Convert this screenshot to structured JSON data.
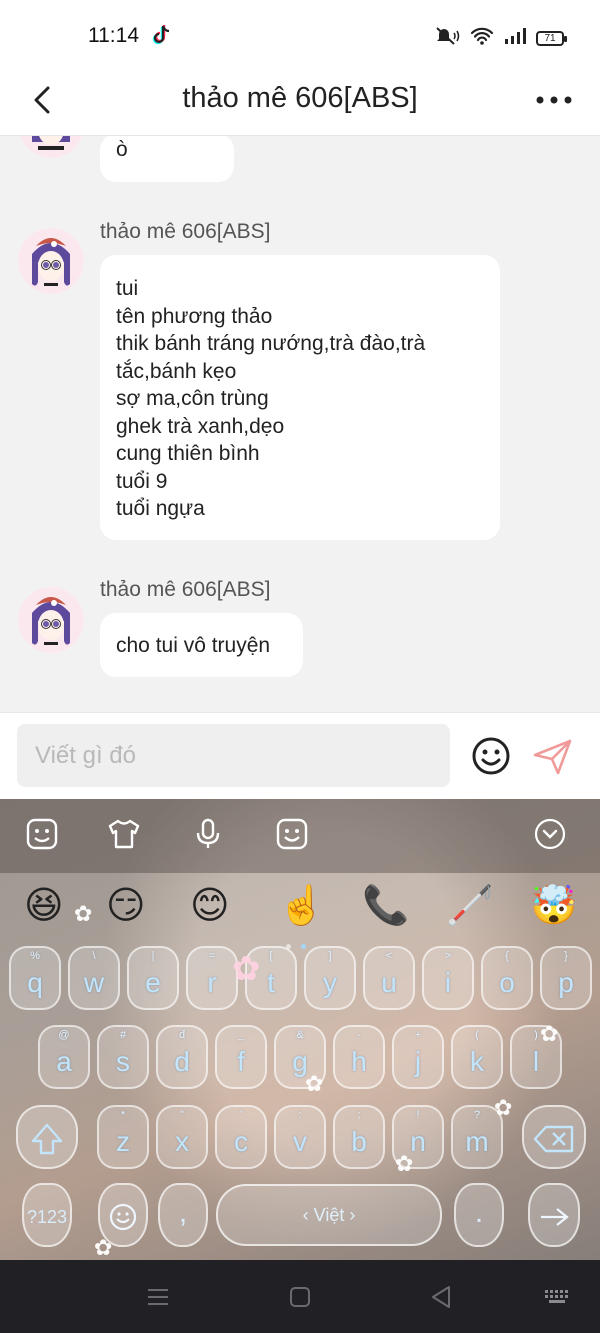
{
  "status_bar": {
    "time": "11:14",
    "battery": "71"
  },
  "header": {
    "title": "thảo mê 606[ABS]"
  },
  "messages": [
    {
      "sender": "",
      "lines": [
        "ò"
      ]
    },
    {
      "sender": "thảo mê 606[ABS]",
      "lines": [
        "tui",
        "tên phương thảo",
        "thik bánh tráng nướng,trà đào,trà",
        "tắc,bánh kẹo",
        "sợ ma,côn trùng",
        "ghek trà xanh,dẹo",
        "cung thiên bình",
        "tuổi 9",
        "tuổi ngựa"
      ]
    },
    {
      "sender": "thảo mê 606[ABS]",
      "lines": [
        "cho tui vô truyện"
      ]
    }
  ],
  "composer": {
    "placeholder": "Viết gì đó",
    "value": ""
  },
  "keyboard": {
    "emoji_suggestions": [
      "😆",
      "😏",
      "😊",
      "☝️",
      "📞",
      "🦯",
      "🤯"
    ],
    "row1": [
      {
        "ch": "q",
        "hint": "%"
      },
      {
        "ch": "w",
        "hint": "\\"
      },
      {
        "ch": "e",
        "hint": "|"
      },
      {
        "ch": "r",
        "hint": "="
      },
      {
        "ch": "t",
        "hint": "["
      },
      {
        "ch": "y",
        "hint": "]"
      },
      {
        "ch": "u",
        "hint": "<"
      },
      {
        "ch": "i",
        "hint": ">"
      },
      {
        "ch": "o",
        "hint": "{"
      },
      {
        "ch": "p",
        "hint": "}"
      }
    ],
    "row2": [
      {
        "ch": "a",
        "hint": "@"
      },
      {
        "ch": "s",
        "hint": "#"
      },
      {
        "ch": "d",
        "hint": "đ"
      },
      {
        "ch": "f",
        "hint": "_"
      },
      {
        "ch": "g",
        "hint": "&"
      },
      {
        "ch": "h",
        "hint": "-"
      },
      {
        "ch": "j",
        "hint": "+"
      },
      {
        "ch": "k",
        "hint": "("
      },
      {
        "ch": "l",
        "hint": ")"
      }
    ],
    "row3": [
      {
        "ch": "z",
        "hint": "*"
      },
      {
        "ch": "x",
        "hint": "\""
      },
      {
        "ch": "c",
        "hint": "'"
      },
      {
        "ch": "v",
        "hint": ":"
      },
      {
        "ch": "b",
        "hint": ";"
      },
      {
        "ch": "n",
        "hint": "!"
      },
      {
        "ch": "m",
        "hint": "?"
      }
    ],
    "symbols_label": "?123",
    "comma_label": ",",
    "space_label": "‹ Việt ›",
    "period_label": "."
  }
}
